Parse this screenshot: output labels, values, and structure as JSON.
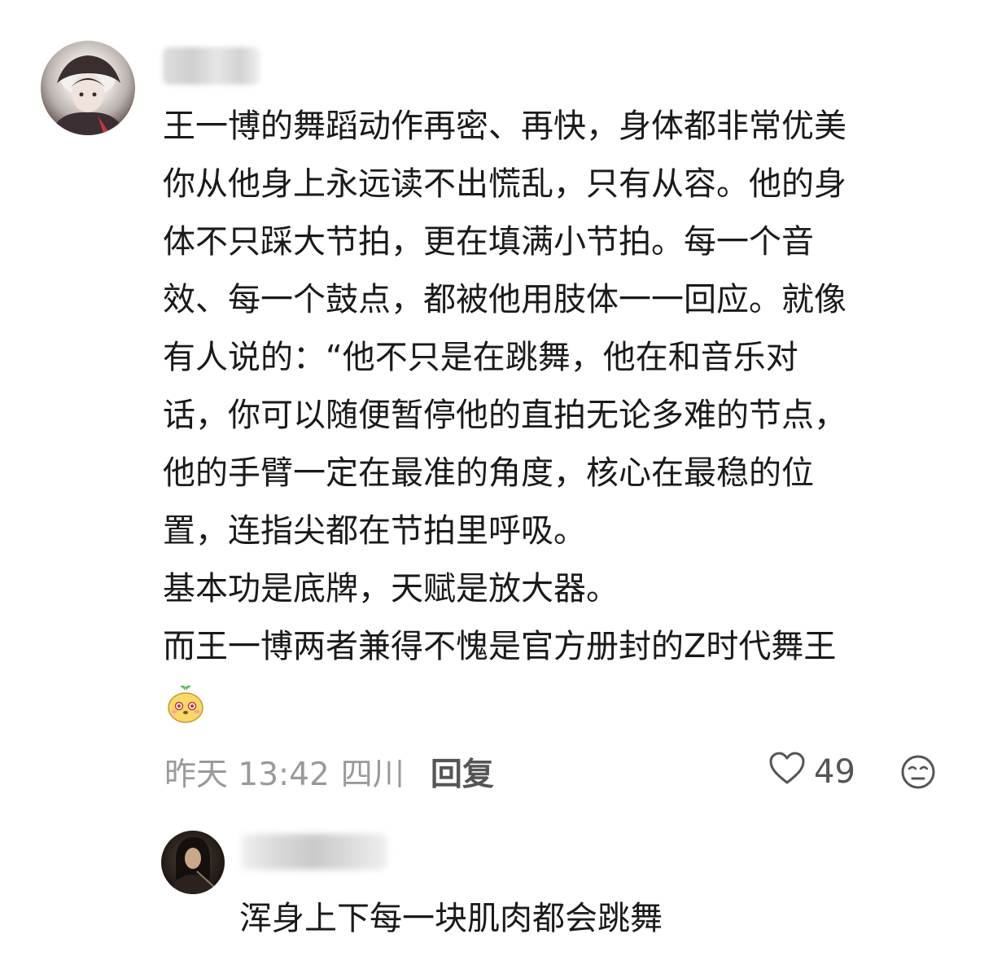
{
  "comment": {
    "lines": [
      "王一博的舞蹈动作再密、再快，身体都非常优美",
      "你从他身上永远读不出慌乱，只有从容。他的身",
      "体不只踩大节拍，更在填满小节拍。每一个音",
      "效、每一个鼓点，都被他用肢体一一回应。就像",
      "有人说的：“他不只是在跳舞，他在和音乐对",
      "话，你可以随便暂停他的直拍无论多难的节点，",
      "他的手臂一定在最准的角度，核心在最稳的位",
      "置，连指尖都在节拍里呼吸。",
      "基本功是底牌，天赋是放大器。",
      "而王一博两者兼得不愧是官方册封的Z时代舞王"
    ],
    "emoji": "smiling-bean-emoji",
    "meta": {
      "time": "昨天 13:42",
      "location": "四川",
      "reply_label": "回复"
    },
    "likes": "49",
    "icons": {
      "like": "heart-outline-icon",
      "dislike": "unamused-face-icon"
    }
  },
  "reply": {
    "text": "浑身上下每一块肌肉都会跳舞"
  },
  "colors": {
    "text": "#1a1a1a",
    "meta": "#9a9a9a",
    "reply_label": "#555555"
  }
}
